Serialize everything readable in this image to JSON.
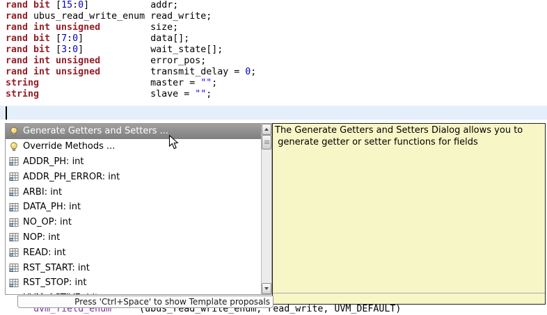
{
  "syntax_colors": {
    "keyword": "#941E26",
    "number": "#0000C0",
    "string": "#2A00FF",
    "plain": "#000000",
    "macro": "#7B2E9E"
  },
  "editor": {
    "code_lines": [
      [
        {
          "t": "rand bit",
          "c": "keyword"
        },
        {
          "t": " [",
          "c": "plain"
        },
        {
          "t": "15",
          "c": "number"
        },
        {
          "t": ":",
          "c": "plain"
        },
        {
          "t": "0",
          "c": "number"
        },
        {
          "t": "]           ",
          "c": "plain"
        },
        {
          "t": "addr;",
          "c": "plain"
        }
      ],
      [
        {
          "t": "rand",
          "c": "keyword"
        },
        {
          "t": " ubus_read_write_enum ",
          "c": "plain"
        },
        {
          "t": "read_write;",
          "c": "plain"
        }
      ],
      [
        {
          "t": "rand int unsigned",
          "c": "keyword"
        },
        {
          "t": "         ",
          "c": "plain"
        },
        {
          "t": "size;",
          "c": "plain"
        }
      ],
      [
        {
          "t": "rand bit",
          "c": "keyword"
        },
        {
          "t": " [",
          "c": "plain"
        },
        {
          "t": "7",
          "c": "number"
        },
        {
          "t": ":",
          "c": "plain"
        },
        {
          "t": "0",
          "c": "number"
        },
        {
          "t": "]            ",
          "c": "plain"
        },
        {
          "t": "data[];",
          "c": "plain"
        }
      ],
      [
        {
          "t": "rand bit",
          "c": "keyword"
        },
        {
          "t": " [",
          "c": "plain"
        },
        {
          "t": "3",
          "c": "number"
        },
        {
          "t": ":",
          "c": "plain"
        },
        {
          "t": "0",
          "c": "number"
        },
        {
          "t": "]            ",
          "c": "plain"
        },
        {
          "t": "wait_state[];",
          "c": "plain"
        }
      ],
      [
        {
          "t": "rand int unsigned",
          "c": "keyword"
        },
        {
          "t": "         ",
          "c": "plain"
        },
        {
          "t": "error_pos;",
          "c": "plain"
        }
      ],
      [
        {
          "t": "rand int unsigned",
          "c": "keyword"
        },
        {
          "t": "         ",
          "c": "plain"
        },
        {
          "t": "transmit_delay = ",
          "c": "plain"
        },
        {
          "t": "0",
          "c": "number"
        },
        {
          "t": ";",
          "c": "plain"
        }
      ],
      [
        {
          "t": "string",
          "c": "keyword"
        },
        {
          "t": "                    ",
          "c": "plain"
        },
        {
          "t": "master = ",
          "c": "plain"
        },
        {
          "t": "\"\"",
          "c": "string"
        },
        {
          "t": ";",
          "c": "plain"
        }
      ],
      [
        {
          "t": "string",
          "c": "keyword"
        },
        {
          "t": "                    ",
          "c": "plain"
        },
        {
          "t": "slave = ",
          "c": "plain"
        },
        {
          "t": "\"\"",
          "c": "string"
        },
        {
          "t": ";",
          "c": "plain"
        }
      ]
    ],
    "partial_bottom_line": [
      {
        "t": "    ",
        "c": "plain"
      },
      {
        "t": "`uvm_field_enum",
        "c": "macro"
      },
      {
        "t": "     (ubus_read_write_enum, read_write, UVM_DEFAULT)",
        "c": "plain"
      }
    ]
  },
  "completion_popup": {
    "items": [
      {
        "icon": "lightbulb",
        "label": "Generate Getters and Setters ...",
        "selected": true
      },
      {
        "icon": "lightbulb",
        "label": "Override Methods ...",
        "selected": false
      },
      {
        "icon": "enum-value",
        "label": "ADDR_PH: int",
        "selected": false
      },
      {
        "icon": "enum-value",
        "label": "ADDR_PH_ERROR: int",
        "selected": false
      },
      {
        "icon": "enum-value",
        "label": "ARBI: int",
        "selected": false
      },
      {
        "icon": "enum-value",
        "label": "DATA_PH: int",
        "selected": false
      },
      {
        "icon": "enum-value",
        "label": "NO_OP: int",
        "selected": false
      },
      {
        "icon": "enum-value",
        "label": "NOP: int",
        "selected": false
      },
      {
        "icon": "enum-value",
        "label": "READ: int",
        "selected": false
      },
      {
        "icon": "enum-value",
        "label": "RST_START: int",
        "selected": false
      },
      {
        "icon": "enum-value",
        "label": "RST_STOP: int",
        "selected": false
      },
      {
        "icon": "enum-value",
        "label": "UVM_ACTIVE: bit",
        "selected": false
      }
    ],
    "status_text": "Press 'Ctrl+Space' to show Template proposals"
  },
  "doc_tooltip": {
    "line1": "The Generate Getters and Setters Dialog allows you to",
    "line2": " generate getter or setter functions for fields"
  }
}
